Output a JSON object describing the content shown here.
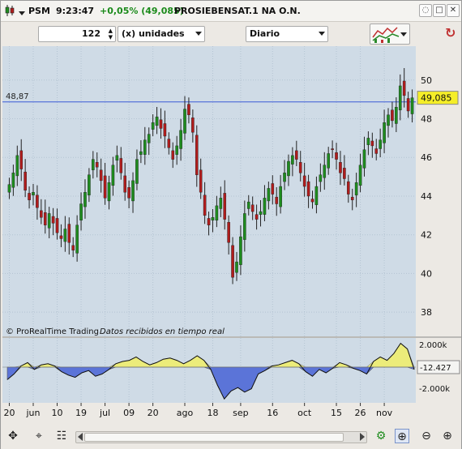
{
  "titlebar": {
    "ticker": "PSM",
    "time": "9:23:47",
    "change": "+0,05% (49,085)",
    "change_color": "#1a8a1a",
    "instrument": "PROSIEBENSAT.1  NA O.N."
  },
  "toolbar": {
    "quantity": "122",
    "units": "(x) unidades",
    "period": "Diario"
  },
  "chart": {
    "copyright": "© ProRealTime Trading",
    "status": "Datos recibidos en tiempo real",
    "hline_label": "48,87",
    "price_tag": "49,085",
    "volume_value": "-12.427",
    "y_ticks": [
      "50",
      "48",
      "46",
      "44",
      "42",
      "40",
      "38"
    ],
    "vol_ticks": [
      "2.000k",
      "-2.000k"
    ],
    "x_labels": [
      "20",
      "jun",
      "10",
      "19",
      "jul",
      "09",
      "20",
      "ago",
      "18",
      "sep",
      "16",
      "oct",
      "15",
      "26",
      "nov"
    ],
    "colors": {
      "background": "#cfdbe6",
      "grid": "#b4c4d2",
      "up": "#1e8c1e",
      "down": "#b01c1c",
      "hline": "#3b5bd6",
      "price_tag_bg": "#f5ee28",
      "volume_pos": "#ecec7a",
      "volume_neg": "#5b74d8"
    }
  },
  "chart_data": {
    "type": "candlestick",
    "x_tick_labels": [
      "20",
      "jun",
      "10",
      "19",
      "jul",
      "09",
      "20",
      "ago",
      "18",
      "sep",
      "16",
      "oct",
      "15",
      "26",
      "nov"
    ],
    "y_ticks": [
      38,
      40,
      42,
      44,
      46,
      48,
      50
    ],
    "ylim": [
      37.0,
      51.5
    ],
    "reference_line": 48.87,
    "last_price": 49.085,
    "closes": [
      44.6,
      45.2,
      46.1,
      45.4,
      44.3,
      43.8,
      44.2,
      43.4,
      42.9,
      42.5,
      43.1,
      42.6,
      42.1,
      41.8,
      42.3,
      41.6,
      41.2,
      42.5,
      43.6,
      44.2,
      45.1,
      45.9,
      45.5,
      44.8,
      43.9,
      44.7,
      45.6,
      46.1,
      45.2,
      44.2,
      43.9,
      44.8,
      45.9,
      46.3,
      46.9,
      47.2,
      47.8,
      48.1,
      47.5,
      47.1,
      46.5,
      45.9,
      46.6,
      47.4,
      48.5,
      48.2,
      47.3,
      45.1,
      44.2,
      43.0,
      42.5,
      42.9,
      43.5,
      43.9,
      42.8,
      41.6,
      39.8,
      40.6,
      41.9,
      43.1,
      43.7,
      43.2,
      42.8,
      43.2,
      43.9,
      44.4,
      44.1,
      43.6,
      44.5,
      45.2,
      45.8,
      46.1,
      45.9,
      45.2,
      44.5,
      44.0,
      43.7,
      44.5,
      45.1,
      45.6,
      46.2,
      46.4,
      45.9,
      45.2,
      44.9,
      44.1,
      43.8,
      44.7,
      45.6,
      46.4,
      47.0,
      46.6,
      46.2,
      46.9,
      47.8,
      48.2,
      47.9,
      48.6,
      49.7,
      49.2,
      48.4,
      49.085
    ],
    "volume_oscillator": [
      -1.1,
      -0.6,
      0.1,
      0.4,
      -0.2,
      0.2,
      0.3,
      0.1,
      -0.4,
      -0.7,
      -0.9,
      -0.5,
      -0.3,
      -0.8,
      -0.6,
      -0.2,
      0.3,
      0.5,
      0.6,
      0.9,
      0.5,
      0.2,
      0.4,
      0.7,
      0.8,
      0.6,
      0.3,
      0.6,
      1.0,
      0.6,
      -0.2,
      -1.6,
      -2.8,
      -2.1,
      -1.8,
      -2.2,
      -1.9,
      -0.6,
      -0.3,
      0.1,
      0.2,
      0.4,
      0.6,
      0.3,
      -0.4,
      -0.8,
      -0.2,
      -0.5,
      -0.1,
      0.4,
      0.2,
      -0.1,
      -0.3,
      -0.6,
      0.5,
      0.9,
      0.6,
      1.2,
      2.1,
      1.6,
      -0.2
    ]
  },
  "bottombar": {
    "icons": [
      "move-icon",
      "cursor-icon",
      "list-icon",
      "chart-settings-icon",
      "zoom-area-icon",
      "zoom-out-icon",
      "zoom-in-icon"
    ]
  }
}
